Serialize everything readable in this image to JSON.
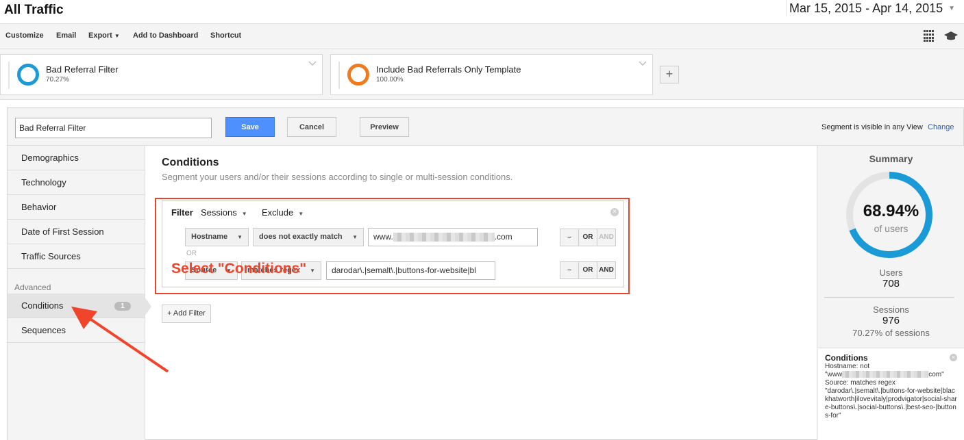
{
  "header": {
    "title": "All Traffic",
    "date_range": "Mar 15, 2015 - Apr 14, 2015"
  },
  "toolbar": {
    "customize": "Customize",
    "email": "Email",
    "export": "Export",
    "add_to_dashboard": "Add to Dashboard",
    "shortcut": "Shortcut"
  },
  "segments": [
    {
      "name": "Bad Referral Filter",
      "percent": "70.27%",
      "color": "#1a9bd7"
    },
    {
      "name": "Include Bad Referrals Only Template",
      "percent": "100.00%",
      "color": "#f07b1e"
    }
  ],
  "add_segment_label": "+",
  "editor": {
    "segment_name": "Bad Referral Filter",
    "save": "Save",
    "cancel": "Cancel",
    "preview": "Preview",
    "visibility_text": "Segment is visible in any View",
    "change": "Change"
  },
  "nav": {
    "items": [
      "Demographics",
      "Technology",
      "Behavior",
      "Date of First Session",
      "Traffic Sources"
    ],
    "advanced_heading": "Advanced",
    "conditions": "Conditions",
    "conditions_count": "1",
    "sequences": "Sequences"
  },
  "conditions": {
    "title": "Conditions",
    "description": "Segment your users and/or their sessions according to single or multi-session conditions.",
    "filter_label": "Filter",
    "scope": "Sessions",
    "mode": "Exclude",
    "rows": [
      {
        "dimension": "Hostname",
        "operator": "does not exactly match",
        "value_prefix": "www.",
        "value_suffix": ".com"
      },
      {
        "dimension": "Source",
        "operator": "matches regex",
        "value": "darodar\\.|semalt\\.|buttons-for-website|bl"
      }
    ],
    "or_separator": "OR",
    "minus": "–",
    "or": "OR",
    "and": "AND",
    "add_filter": "+ Add Filter"
  },
  "annotation": "Select \"Conditions\"",
  "summary": {
    "title": "Summary",
    "percent": "68.94%",
    "percent_value": 68.94,
    "percent_label": "of users",
    "users_label": "Users",
    "users_value": "708",
    "sessions_label": "Sessions",
    "sessions_value": "976",
    "sessions_pct": "70.27% of sessions",
    "cond_title": "Conditions",
    "cond_line1": "Hostname: not",
    "cond_line2_prefix": "\"www",
    "cond_line2_suffix": "com\"",
    "cond_line3": "Source: matches regex",
    "cond_line4": "\"darodar\\.|semalt\\.|buttons-for-website|blackhatworth|ilovevitaly|prodvigator|social-share-buttons\\.|social-buttons\\.|best-seo-|buttons-for\""
  },
  "colors": {
    "accent_blue": "#1a9bd7",
    "accent_orange": "#f07b1e",
    "highlight_red": "#e8432b",
    "save_blue": "#4d90fe"
  }
}
